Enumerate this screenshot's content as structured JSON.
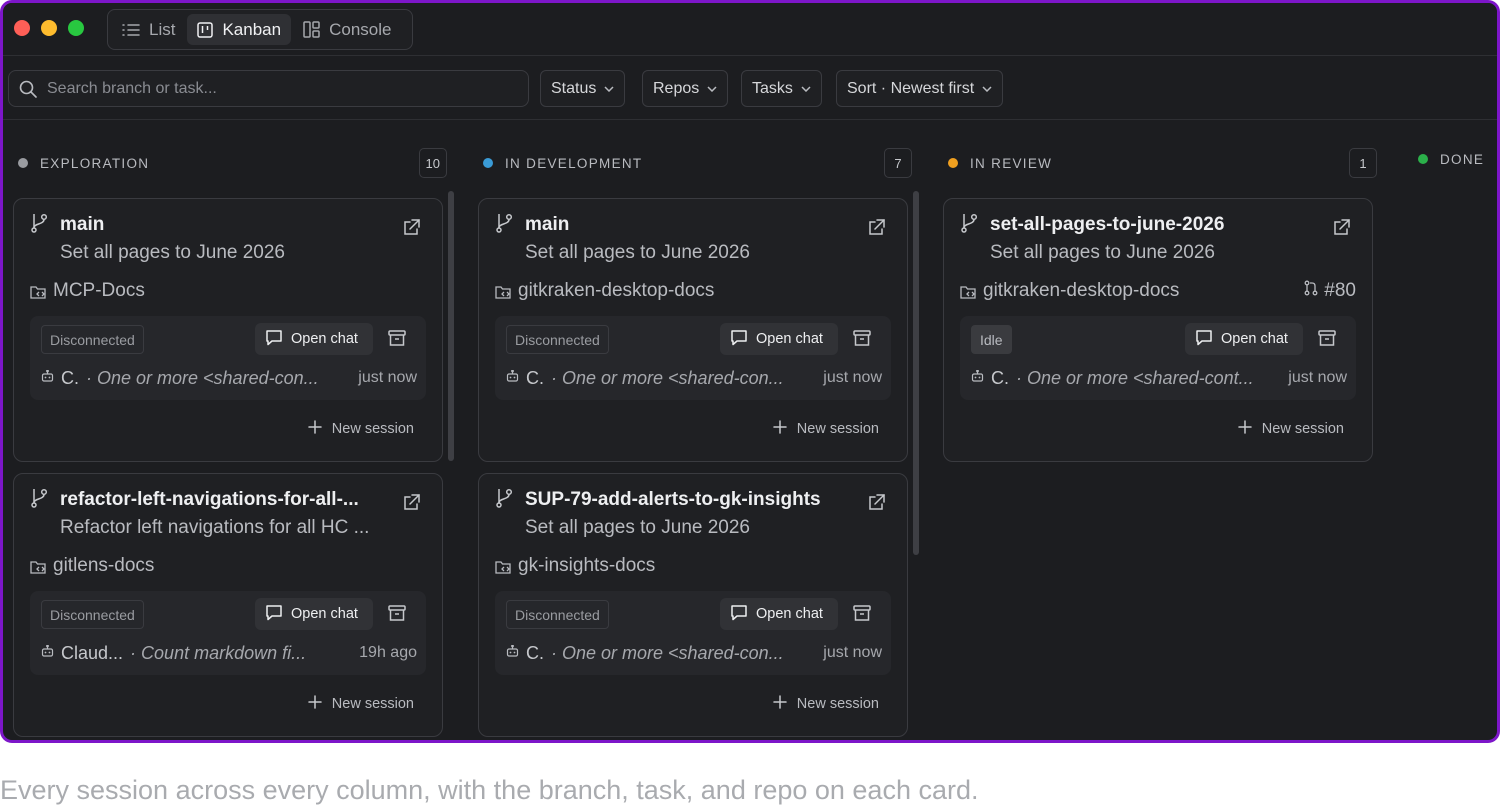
{
  "window": {
    "traffic_lights": [
      {
        "name": "close",
        "color": "#fe5f57"
      },
      {
        "name": "minimize",
        "color": "#febc2e"
      },
      {
        "name": "zoom",
        "color": "#28c840"
      }
    ]
  },
  "views": {
    "list": "List",
    "kanban": "Kanban",
    "console": "Console",
    "active": "Kanban"
  },
  "filters": {
    "search_placeholder": "Search branch or task...",
    "status": "Status",
    "repos": "Repos",
    "tasks": "Tasks",
    "sort": "Sort · Newest first"
  },
  "columns": [
    {
      "title": "EXPLORATION",
      "count": "10",
      "dot_color": "#9a9ca1",
      "cards": [
        {
          "branch": "main",
          "task": "Set all pages to June 2026",
          "repo": "MCP-Docs",
          "pr": "",
          "status": "Disconnected",
          "open_chat": "Open chat",
          "agent": "C.",
          "message": "· One or more <shared-con...",
          "time": "just now",
          "new_session": "New session"
        },
        {
          "branch": "refactor-left-navigations-for-all-...",
          "task": "Refactor left navigations for all HC ...",
          "repo": "gitlens-docs",
          "pr": "",
          "status": "Disconnected",
          "open_chat": "Open chat",
          "agent": "Claud...",
          "message": "· Count markdown fi...",
          "time": "19h ago",
          "new_session": "New session"
        }
      ]
    },
    {
      "title": "IN DEVELOPMENT",
      "count": "7",
      "dot_color": "#3a9bd6",
      "cards": [
        {
          "branch": "main",
          "task": "Set all pages to June 2026",
          "repo": "gitkraken-desktop-docs",
          "pr": "",
          "status": "Disconnected",
          "open_chat": "Open chat",
          "agent": "C.",
          "message": "· One or more <shared-con...",
          "time": "just now",
          "new_session": "New session"
        },
        {
          "branch": "SUP-79-add-alerts-to-gk-insights",
          "task": "Set all pages to June 2026",
          "repo": "gk-insights-docs",
          "pr": "",
          "status": "Disconnected",
          "open_chat": "Open chat",
          "agent": "C.",
          "message": "· One or more <shared-con...",
          "time": "just now",
          "new_session": "New session"
        }
      ]
    },
    {
      "title": "IN REVIEW",
      "count": "1",
      "dot_color": "#f0a020",
      "cards": [
        {
          "branch": "set-all-pages-to-june-2026",
          "task": "Set all pages to June 2026",
          "repo": "gitkraken-desktop-docs",
          "pr": "#80",
          "status": "Idle",
          "open_chat": "Open chat",
          "agent": "C.",
          "message": "· One or more <shared-cont...",
          "time": "just now",
          "new_session": "New session"
        }
      ]
    },
    {
      "title": "DONE",
      "count": "",
      "dot_color": "#2bb04a",
      "cards": []
    }
  ],
  "caption": "Every session across every column, with the branch, task, and repo on each card."
}
